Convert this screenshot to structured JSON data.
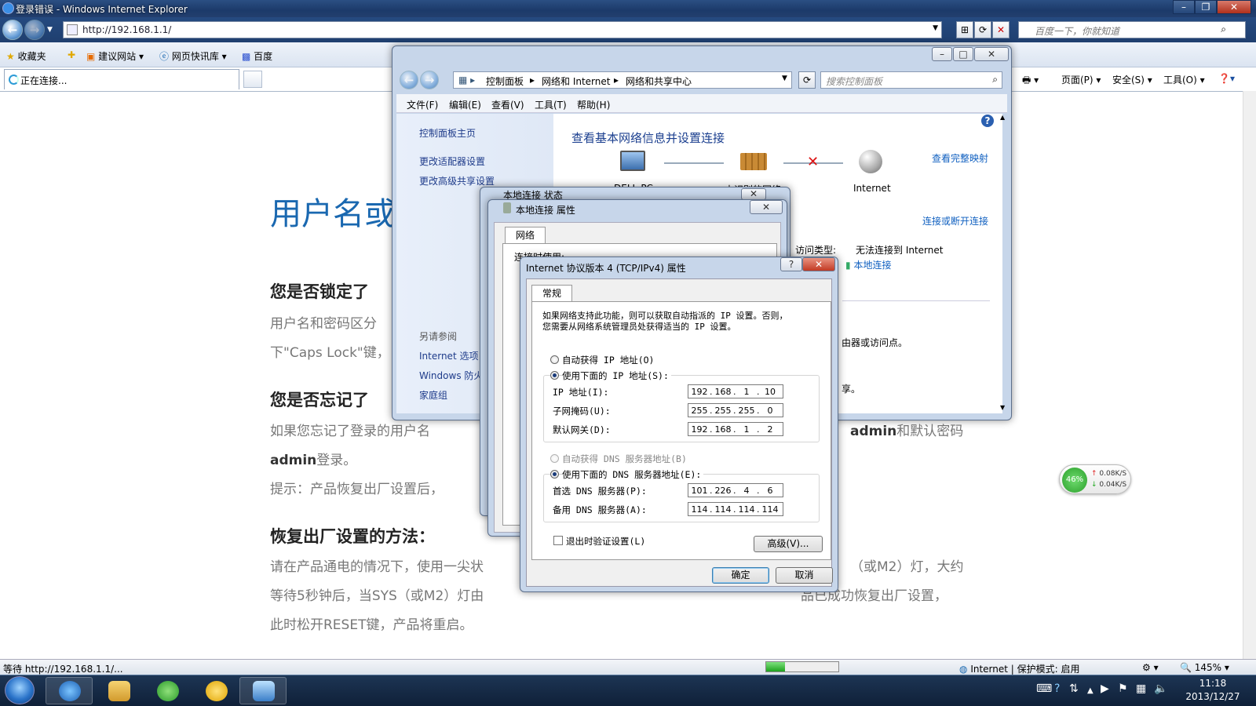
{
  "ie": {
    "title": "登录错误 - Windows Internet Explorer",
    "url": "http://192.168.1.1/",
    "search_placeholder": "百度一下，你就知道",
    "favorites": [
      "收藏夹",
      "建议网站",
      "网页快讯库",
      "百度"
    ],
    "tab_title": "正在连接...",
    "commands": [
      "页面(P)",
      "安全(S)",
      "工具(O)"
    ],
    "status_text": "等待 http://192.168.1.1/...",
    "zone": "Internet | 保护模式: 启用",
    "zoom": "145%",
    "progress": 0.26
  },
  "page": {
    "heading": "用户名或",
    "s1_title": "您是否锁定了",
    "s1_p1": "用户名和密码区分",
    "s1_p2": "下\"Caps Lock\"键，",
    "s2_title": "您是否忘记了",
    "s2_p1a": "如果您忘记了登录的用户名",
    "s2_p1_bold1": "admin",
    "s2_p1b": "和默认密码",
    "s2_p2_bold": "admin",
    "s2_p2": "登录。",
    "s2_p3": "提示：产品恢复出厂设置后，",
    "s3_title": "恢复出厂设置的方法：",
    "s3_p1a": "请在产品通电的情况下，使用一尖状",
    "s3_p1b": "（或M2）灯，大约",
    "s3_p2a": "等待5秒钟后，当SYS（或M2）灯由",
    "s3_p2b": "品已成功恢复出厂设置，",
    "s3_p3": "此时松开RESET键，产品将重启。"
  },
  "net_widget": {
    "percent": "46%",
    "up": "0.08K/S",
    "down": "0.04K/S"
  },
  "control_panel": {
    "breadcrumb": [
      "控制面板",
      "网络和 Internet",
      "网络和共享中心"
    ],
    "search_placeholder": "搜索控制面板",
    "menu": [
      "文件(F)",
      "编辑(E)",
      "查看(V)",
      "工具(T)",
      "帮助(H)"
    ],
    "left_links": [
      "控制面板主页",
      "更改适配器设置",
      "更改高级共享设置"
    ],
    "see_also_title": "另请参阅",
    "see_also": [
      "Internet 选项",
      "Windows 防火墙",
      "家庭组"
    ],
    "main_title": "查看基本网络信息并设置连接",
    "view_full_map": "查看完整映射",
    "pc_label": "DELL-PC",
    "network_label": "未识别的网络",
    "internet_label": "Internet",
    "connect_disconnect": "连接或断开连接",
    "access_type_label": "访问类型:",
    "access_type_value": "无法连接到 Internet",
    "connection_link": "本地连接",
    "frag1": "由器或访问点。",
    "frag2": "享。"
  },
  "status_dialog": {
    "title": "本地连接 状态"
  },
  "props_dialog": {
    "title": "本地连接 属性",
    "tab": "网络",
    "conn_using": "连接时使用:"
  },
  "ipv4_dialog": {
    "title": "Internet 协议版本 4 (TCP/IPv4) 属性",
    "tab": "常规",
    "desc1": "如果网络支持此功能，则可以获取自动指派的 IP 设置。否则，",
    "desc2": "您需要从网络系统管理员处获得适当的 IP 设置。",
    "auto_ip": "自动获得 IP 地址(O)",
    "manual_ip": "使用下面的 IP 地址(S):",
    "ip_label": "IP 地址(I):",
    "mask_label": "子网掩码(U):",
    "gateway_label": "默认网关(D):",
    "ip": [
      "192",
      "168",
      "1",
      "10"
    ],
    "mask": [
      "255",
      "255",
      "255",
      "0"
    ],
    "gateway": [
      "192",
      "168",
      "1",
      "2"
    ],
    "auto_dns": "自动获得 DNS 服务器地址(B)",
    "manual_dns": "使用下面的 DNS 服务器地址(E):",
    "pref_dns_label": "首选 DNS 服务器(P):",
    "alt_dns_label": "备用 DNS 服务器(A):",
    "pref_dns": [
      "101",
      "226",
      "4",
      "6"
    ],
    "alt_dns": [
      "114",
      "114",
      "114",
      "114"
    ],
    "validate": "退出时验证设置(L)",
    "advanced": "高级(V)...",
    "ok": "确定",
    "cancel": "取消",
    "help": "?"
  },
  "taskbar": {
    "time": "11:18",
    "date": "2013/12/27"
  },
  "colors": {
    "link_blue": "#1a68b0",
    "accent": "#2b4f83"
  }
}
